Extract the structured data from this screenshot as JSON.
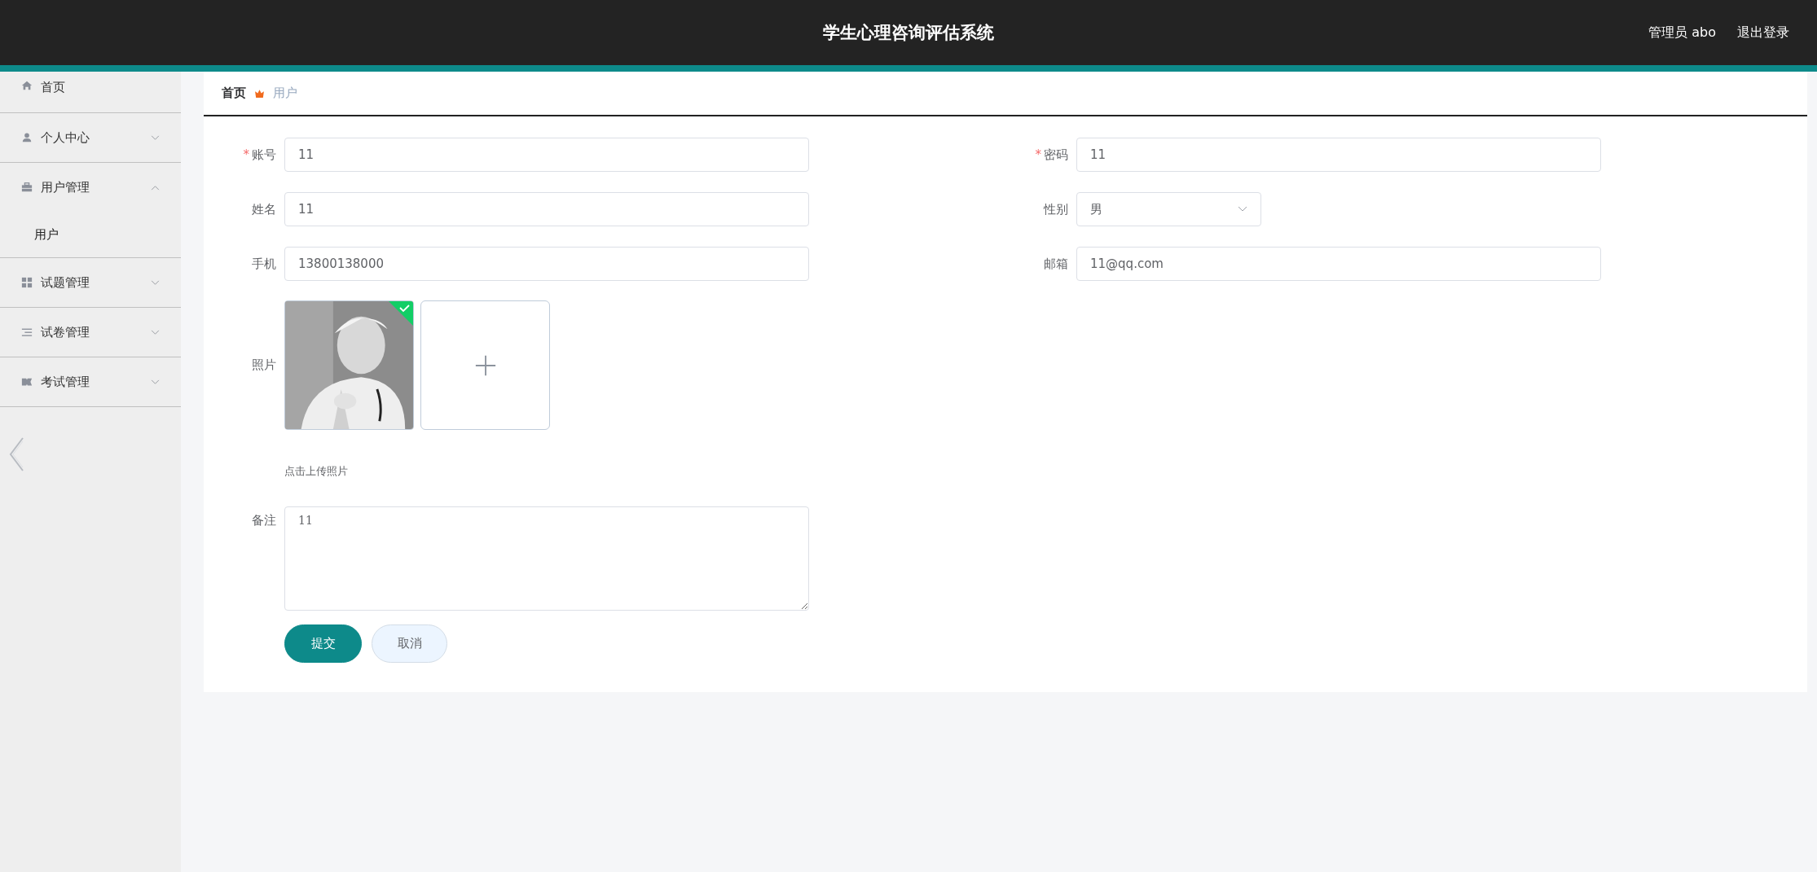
{
  "header": {
    "title": "学生心理咨询评估系统",
    "user": "管理员 abo",
    "logout": "退出登录"
  },
  "sidebar": {
    "items": [
      {
        "label": "首页",
        "kind": "link"
      },
      {
        "label": "个人中心",
        "kind": "menu",
        "expanded": false
      },
      {
        "label": "用户管理",
        "kind": "menu",
        "expanded": true,
        "children": [
          {
            "label": "用户"
          }
        ]
      },
      {
        "label": "试题管理",
        "kind": "menu",
        "expanded": false
      },
      {
        "label": "试卷管理",
        "kind": "menu",
        "expanded": false
      },
      {
        "label": "考试管理",
        "kind": "menu",
        "expanded": false
      }
    ]
  },
  "breadcrumb": [
    {
      "label": "首页",
      "current": false
    },
    {
      "label": "用户",
      "current": true
    }
  ],
  "form": {
    "fields": [
      {
        "label": "账号",
        "required_mark": "*",
        "kind": "text",
        "value": "11"
      },
      {
        "label": "密码",
        "required_mark": "*",
        "kind": "text",
        "value": "11"
      },
      {
        "label": "姓名",
        "kind": "text",
        "value": "11"
      },
      {
        "label": "性别",
        "kind": "select",
        "value": "男"
      },
      {
        "label": "手机",
        "kind": "text",
        "value": "13800138000"
      },
      {
        "label": "邮箱",
        "kind": "text",
        "value": "11@qq.com"
      }
    ],
    "photo": {
      "label": "照片",
      "uploaded": true,
      "hint": "点击上传照片"
    },
    "remark": {
      "label": "备注",
      "value": "11"
    },
    "buttons": [
      {
        "label": "提交",
        "kind": "primary"
      },
      {
        "label": "取消",
        "kind": "default"
      }
    ]
  }
}
